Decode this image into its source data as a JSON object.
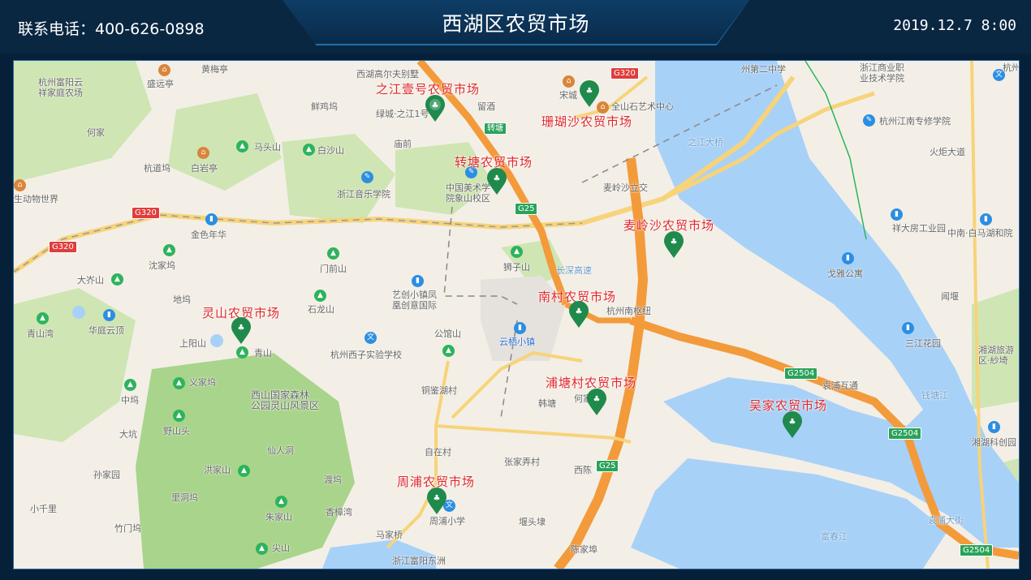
{
  "header": {
    "phone": "联系电话：400-626-0898",
    "title": "西湖区农贸市场",
    "datetime": "2019.12.7   8:00"
  },
  "markets": [
    {
      "name": "之江壹号农贸市场"
    },
    {
      "name": "珊瑚沙农贸市场"
    },
    {
      "name": "转塘农贸市场"
    },
    {
      "name": "麦岭沙农贸市场"
    },
    {
      "name": "南村农贸市场"
    },
    {
      "name": "灵山农贸市场"
    },
    {
      "name": "浦塘村农贸市场"
    },
    {
      "name": "吴家农贸市场"
    },
    {
      "name": "周浦农贸市场"
    }
  ],
  "places": [
    "杭州富阳云\n祥家庭农场",
    "盛远亭",
    "黄梅亭",
    "何家",
    "杭道坞",
    "白岩亭",
    "生动物世界",
    "马头山",
    "白沙山",
    "鲜鸡坞",
    "庙前",
    "浙江音乐学院",
    "金色年华",
    "沈家坞",
    "大岕山",
    "门前山",
    "艺创小镇凤\n凰创意国际",
    "青山湾",
    "华庭云顶",
    "地坞",
    "上阳山",
    "青山",
    "石龙山",
    "公馆山",
    "杭州西子实验学校",
    "云栖小镇",
    "中坞",
    "义家坞",
    "西山国家森林\n公园灵山风景区",
    "铜鉴湖村",
    "韩塘",
    "何家",
    "大坑",
    "野山头",
    "仙人洞",
    "孙家园",
    "洪家山",
    "渡坞",
    "自在村",
    "张家弄村",
    "西陈",
    "小千里",
    "里洞坞",
    "朱家山",
    "香樟湾",
    "竹门坞",
    "尖山",
    "马家桥",
    "堰头埭",
    "陈家埠",
    "浙江富阳东洲",
    "周浦小学",
    "西湖高尔夫别墅",
    "绿城·之江1号",
    "留酒",
    "宋城",
    "全山石艺术中心",
    "州第二中学",
    "浙江商业职\n业技术学院",
    "杭州江南专修学院",
    "火炬大道",
    "麦岭沙立交",
    "中国美术学\n院象山校区",
    "狮子山",
    "杭州南枢纽",
    "祥大房工业园",
    "中南·白马湖和院",
    "戈雅公寓",
    "闻堰",
    "三江花园",
    "湘湖旅游\n区·紗埼",
    "湘湖科创园",
    "袁浦互通",
    "钱塘江",
    "富春江",
    "袁浦大街",
    "之江大桥",
    "长深高速",
    "杭州河"
  ],
  "roads": [
    "G320",
    "G320",
    "G320",
    "G25",
    "G25",
    "G2504",
    "G2504",
    "G2504",
    "转塘"
  ]
}
